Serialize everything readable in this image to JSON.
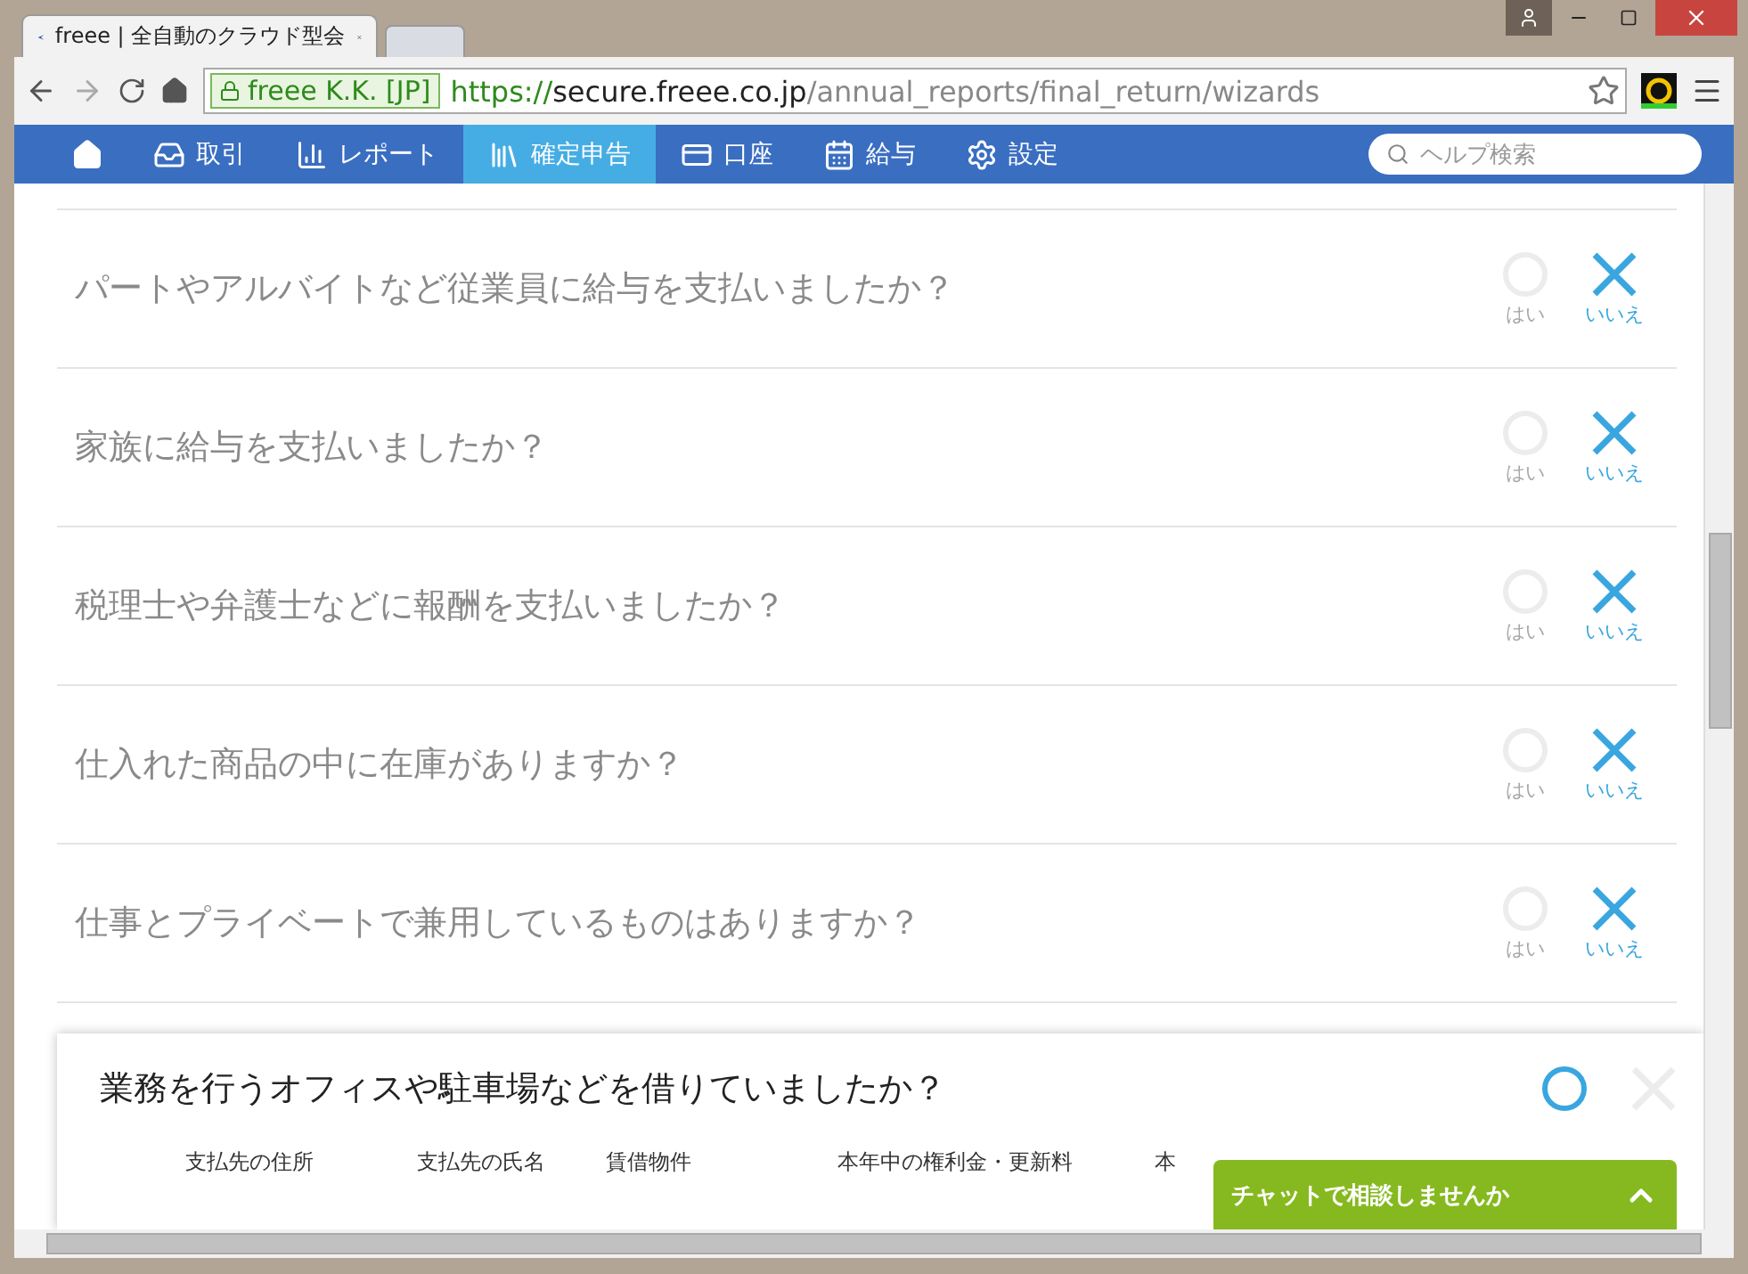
{
  "browser": {
    "tab_title": "freee | 全自動のクラウド型会",
    "security_label": "freee K.K. [JP]",
    "url_scheme": "https://",
    "url_host": "secure.freee.co.jp",
    "url_path": "/annual_reports/final_return/wizards"
  },
  "nav": {
    "items": [
      {
        "kind": "home",
        "selected": false
      },
      {
        "kind": "inbox",
        "label": "取引",
        "selected": false
      },
      {
        "kind": "chart",
        "label": "レポート",
        "selected": false
      },
      {
        "kind": "books",
        "label": "確定申告",
        "selected": true
      },
      {
        "kind": "card",
        "label": "口座",
        "selected": false
      },
      {
        "kind": "calendar",
        "label": "給与",
        "selected": false
      },
      {
        "kind": "gear",
        "label": "設定",
        "selected": false
      }
    ],
    "search": {
      "placeholder": "ヘルプ検索"
    }
  },
  "questions": [
    {
      "text": "パートやアルバイトなど従業員に給与を支払いましたか？",
      "options": [
        {
          "kind": "circle",
          "label": "はい",
          "selected": false
        },
        {
          "kind": "cross",
          "label": "いいえ",
          "selected": true
        }
      ]
    },
    {
      "text": "家族に給与を支払いましたか？",
      "options": [
        {
          "kind": "circle",
          "label": "はい",
          "selected": false
        },
        {
          "kind": "cross",
          "label": "いいえ",
          "selected": true
        }
      ]
    },
    {
      "text": "税理士や弁護士などに報酬を支払いましたか？",
      "options": [
        {
          "kind": "circle",
          "label": "はい",
          "selected": false
        },
        {
          "kind": "cross",
          "label": "いいえ",
          "selected": true
        }
      ]
    },
    {
      "text": "仕入れた商品の中に在庫がありますか？",
      "options": [
        {
          "kind": "circle",
          "label": "はい",
          "selected": false
        },
        {
          "kind": "cross",
          "label": "いいえ",
          "selected": true
        }
      ]
    },
    {
      "text": "仕事とプライベートで兼用しているものはありますか？",
      "options": [
        {
          "kind": "circle",
          "label": "はい",
          "selected": false
        },
        {
          "kind": "cross",
          "label": "いいえ",
          "selected": true
        }
      ]
    }
  ],
  "open_question": {
    "text": "業務を行うオフィスや駐車場などを借りていましたか？",
    "options": [
      {
        "kind": "circle",
        "selected": true
      },
      {
        "kind": "cross",
        "selected": false
      }
    ],
    "columns": [
      "支払先の住所",
      "支払先の氏名",
      "賃借物件",
      "本年中の権利金・更新料",
      "本"
    ]
  },
  "chat": {
    "label": "チャットで相談しませんか"
  }
}
